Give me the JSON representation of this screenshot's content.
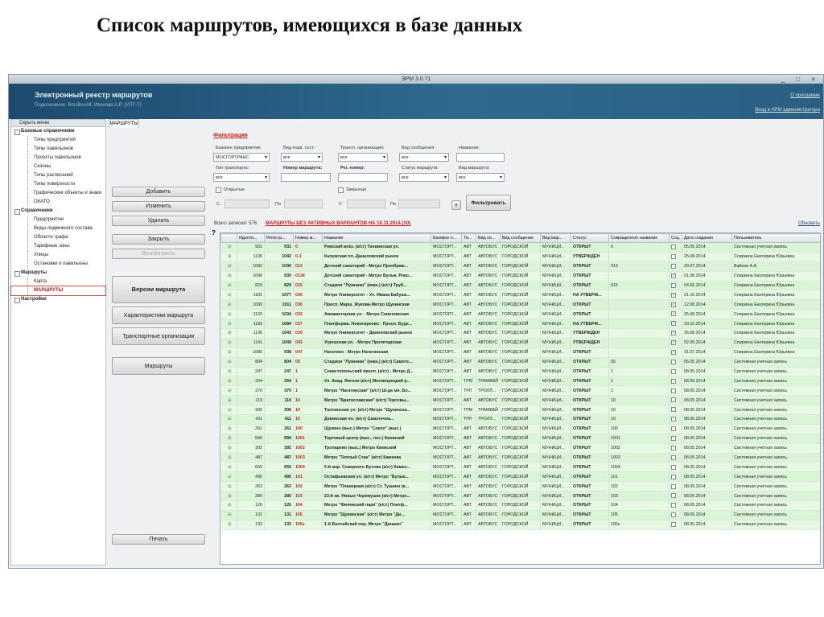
{
  "slide_title": "Список маршрутов, имеющихся в базе данных",
  "window": {
    "title": "ЭРМ 3.0.71",
    "controls": "_ □ ×"
  },
  "banner": {
    "app_name": "Электронный реестр маршрутов",
    "subtitle": "Подключение: BmsBoxAll, Иванова А.Р. (УПТ-Т)",
    "about_link": "О программе",
    "admin_link": "Вход в АРМ администратора"
  },
  "nav": {
    "hide_label": "Скрыть меню",
    "items": [
      {
        "label": "Базовые справочники",
        "type": "grp"
      },
      {
        "label": "Типы предприятий",
        "type": "leaf"
      },
      {
        "label": "Типы павильонов",
        "type": "leaf"
      },
      {
        "label": "Проекты павильонов",
        "type": "leaf"
      },
      {
        "label": "Сезоны",
        "type": "leaf"
      },
      {
        "label": "Типы расписаний",
        "type": "leaf"
      },
      {
        "label": "Типы поверхности",
        "type": "leaf"
      },
      {
        "label": "Графические объекты и знаки",
        "type": "leaf"
      },
      {
        "label": "ОКАТО",
        "type": "leaf"
      },
      {
        "label": "Справочники",
        "type": "grp"
      },
      {
        "label": "Предприятия",
        "type": "leaf"
      },
      {
        "label": "Виды подвижного состава",
        "type": "leaf"
      },
      {
        "label": "Области графа",
        "type": "leaf"
      },
      {
        "label": "Тарифные зоны",
        "type": "leaf"
      },
      {
        "label": "Улицы",
        "type": "leaf"
      },
      {
        "label": "Остановки и павильоны",
        "type": "leaf"
      },
      {
        "label": "Маршруты",
        "type": "grp"
      },
      {
        "label": "Карта",
        "type": "leaf"
      },
      {
        "label": "МАРШРУТЫ",
        "type": "leaf",
        "selected": true
      },
      {
        "label": "Настройки",
        "type": "grp"
      }
    ]
  },
  "tab": {
    "label": "МАРШРУТЫ"
  },
  "buttons": {
    "add": "Добавить",
    "edit": "Изменить",
    "delete": "Удалить",
    "close": "Закрыть",
    "reopen": "Возобновить",
    "versions": "Версии маршрута",
    "characteristics": "Характеристики маршрута",
    "carriers": "Транспортные организации",
    "routes": "Маршруты",
    "print": "Печать"
  },
  "filter": {
    "header": "Фильтрация",
    "base_enterprise": {
      "label": "Базовое предприятие:",
      "value": "МОСГОРТРАНС"
    },
    "subst_type": {
      "label": "Вид подв. сост.:",
      "value": "все"
    },
    "transport_org": {
      "label": "Трансп. организация:",
      "value": "все"
    },
    "msg_type": {
      "label": "Вид сообщения:",
      "value": "все"
    },
    "name": {
      "label": "Название:"
    },
    "transport_type": {
      "label": "Тип транспорта:",
      "value": "все"
    },
    "route_number": {
      "label": "Номер маршрута:"
    },
    "reg_number": {
      "label": "Рег. номер:"
    },
    "route_status": {
      "label": "Статус маршрута:",
      "value": "все"
    },
    "route_kind": {
      "label": "Вид маршрута:",
      "value": "все"
    },
    "opened": "Открытые",
    "closed": "Закрытые",
    "from1": "С",
    "to1": "По",
    "from2": "С",
    "to2": "По",
    "plus": "+",
    "apply": "Фильтровать"
  },
  "total": "Всего записей: 576",
  "warning": "МАРШРУТЫ БЕЗ АКТИВНЫХ ВАРИАНТОВ НА 18.11.2014 (10)",
  "refresh": "Обновить",
  "qmark": "?",
  "table": {
    "columns": [
      "",
      "Иденти...",
      "Регистр...",
      "Номер м...",
      "Название",
      "Базовое п...",
      "Ти...",
      "Вид по...",
      "Вид сообщения",
      "Вид мар...",
      "Статус",
      "Сокращенное название",
      "Соц.",
      "Дата создания",
      "Пользователь"
    ],
    "rows": [
      [
        "931",
        "931",
        "0",
        "Рижский вокз. (к/ст) Тихвинская ул.",
        "МОСГОРТ...",
        "АВТ",
        "АВТОБУС",
        "ГОРОДСКОЙ",
        "МУНИЦИ...",
        "ОТКРЫТ",
        "0",
        "",
        "05.05.2014",
        "Системная учетная запись"
      ],
      [
        "1135",
        "1042",
        "0-1",
        "Калужская пл.-Даниловский рынок",
        "МОСГОРТ...",
        "АВТ",
        "АВТОБУС",
        "ГОРОДСКОЙ",
        "МУНИЦИ...",
        "УТВЕРЖДЕН",
        "",
        "",
        "25.08.2014",
        "Спиркина Екатерина Юрьевна"
      ],
      [
        "1082",
        "1030",
        "013",
        "Детский санаторий - Метро Преображ...",
        "МОСГОРТ...",
        "АВТ",
        "АВТОБУС",
        "ГОРОДСКОЙ",
        "МУНИЦИ...",
        "ОТКРЫТ",
        "013",
        "",
        "29.07.2014",
        "Вайнов А.А."
      ],
      [
        "1096",
        "930",
        "013К",
        "Детский санаторий - Метро Бульв. Роко...",
        "МОСГОРТ...",
        "АВТ",
        "АВТОБУС",
        "ГОРОДСКОЙ",
        "МУНИЦИ...",
        "ОТКРЫТ",
        "",
        "✓",
        "01.08.2014",
        "Спиркина Екатерина Юрьевна"
      ],
      [
        "829",
        "829",
        "015",
        "Стадион \"Лужники\" (южн.) (к/ст) Труб...",
        "МОСГОРТ...",
        "АВТ",
        "АВТОБУС",
        "ГОРОДСКОЙ",
        "МУНИЦИ...",
        "ОТКРЫТ",
        "015",
        "",
        "04.06.2014",
        "Спиркина Екатерина Юрьевна"
      ],
      [
        "1181",
        "1077",
        "026",
        "Метро Университет - Ул. Ивана Бабушк...",
        "МОСГОРТ...",
        "АВТ",
        "АВТОБУС",
        "ГОРОДСКОЙ",
        "МУНИЦИ...",
        "НА УТВЕРЖ...",
        "",
        "✓",
        "21.10.2014",
        "Спиркина Екатерина Юрьевна"
      ],
      [
        "1099",
        "1011",
        "030",
        "Просп. Марш. Жукова-Метро Щукинская",
        "МОСГОРТ...",
        "АВТ",
        "АВТОБУС",
        "ГОРОДСКОЙ",
        "МУНИЦИ...",
        "ОТКРЫТ",
        "",
        "✓",
        "12.08.2014",
        "Спиркина Екатерина Юрьевна"
      ],
      [
        "1132",
        "1034",
        "032",
        "Авиамоторная ул. - Метро Семеновская",
        "МОСГОРТ...",
        "АВТ",
        "АВТОБУС",
        "ГОРОДСКОЙ",
        "МУНИЦИ...",
        "ОТКРЫТ",
        "",
        "✓",
        "25.08.2014",
        "Спиркина Екатерина Юрьевна"
      ],
      [
        "1183",
        "1084",
        "037",
        "Платформа. Новогиреево - Просп. Буде...",
        "МОСГОРТ...",
        "АВТ",
        "АВТОБУС",
        "ГОРОДСКОЙ",
        "МУНИЦИ...",
        "НА УТВЕРЖ...",
        "",
        "✓",
        "29.10.2014",
        "Спиркина Екатерина Юрьевна"
      ],
      [
        "1136",
        "1043",
        "039",
        "Метро Университет - Даниловский рынок",
        "МОСГОРТ...",
        "АВТ",
        "АВТОБУС",
        "ГОРОДСКОЙ",
        "МУНИЦИ...",
        "УТВЕРЖДЕН",
        "",
        "✓",
        "26.08.2014",
        "Спиркина Екатерина Юрьевна"
      ],
      [
        "1141",
        "1049",
        "043",
        "Угрешская ул. - Метро Пролетарская",
        "МОСГОРТ...",
        "АВТ",
        "АВТОБУС",
        "ГОРОДСКОЙ",
        "МУНИЦИ...",
        "УТВЕРЖДЕН",
        "",
        "✓",
        "02.09.2014",
        "Спиркина Екатерина Юрьевна"
      ],
      [
        "1085",
        "938",
        "047",
        "Нагатино - Метро Нагатинская",
        "МОСГОРТ...",
        "АВТ",
        "АВТОБУС",
        "ГОРОДСКОЙ",
        "МУНИЦИ...",
        "ОТКРЫТ",
        "",
        "✓",
        "31.07.2014",
        "Спиркина Екатерина Юрьевна"
      ],
      [
        "804",
        "804",
        "05",
        "Стадион \"Лужники\" (южн.) (к/ст) Самоте...",
        "МОСГОРТ...",
        "АВТ",
        "АВТОБУС",
        "ГОРОДСКОЙ",
        "МУНИЦИ...",
        "ОТКРЫТ",
        "05",
        "",
        "05.05.2014",
        "Системная учетная запись"
      ],
      [
        "247",
        "247",
        "1",
        "Севастопольский просп. (к/ст) - Метро Д...",
        "МОСГОРТ...",
        "АВТ",
        "АВТОБУС",
        "ГОРОДСКОЙ",
        "МУНИЦИ...",
        "ОТКРЫТ",
        "1",
        "",
        "08.05.2014",
        "Системная учетная запись"
      ],
      [
        "254",
        "254",
        "1",
        "Ул. Акад. Янгеля (к/ст) Москворецкий р...",
        "МОСГОРТ...",
        "ТРМ",
        "ТРАМВАЙ",
        "ГОРОДСКОЙ",
        "МУНИЦИ...",
        "ОТКРЫТ",
        "1",
        "",
        "08.05.2014",
        "Системная учетная запись"
      ],
      [
        "370",
        "370",
        "1",
        "Метро \"Нагатинская\" (к/ст) Ш-да мн. Бо...",
        "МОСГОРТ...",
        "ТРЛ",
        "ТРОЛЛ...",
        "ГОРОДСКОЙ",
        "МУНИЦИ...",
        "ОТКРЫТ",
        "1",
        "",
        "08.05.2014",
        "Системная учетная запись"
      ],
      [
        "119",
        "119",
        "10",
        "Метро \"Братиславская\" (к/ст) Торговы...",
        "МОСГОРТ...",
        "АВТ",
        "АВТОБУС",
        "ГОРОДСКОЙ",
        "МУНИЦИ...",
        "ОТКРЫТ",
        "10",
        "",
        "08.05.2014",
        "Системная учетная запись"
      ],
      [
        "306",
        "306",
        "10",
        "Таллинская ул. (к/ст) Метро \"Щукинска...",
        "МОСГОРТ...",
        "ТРМ",
        "ТРАМВАЙ",
        "ГОРОДСКОЙ",
        "МУНИЦИ...",
        "ОТКРЫТ",
        "10",
        "",
        "08.05.2014",
        "Системная учетная запись"
      ],
      [
        "411",
        "411",
        "10",
        "Дзвинская пл. (к/ст) Самотечна...",
        "МОСГОРТ...",
        "ТРЛ",
        "ТРОЛЛ...",
        "ГОРОДСКОЙ",
        "МУНИЦИ...",
        "ОТКРЫТ",
        "10",
        "",
        "08.05.2014",
        "Системная учетная запись"
      ],
      [
        "261",
        "261",
        "100",
        "Щукино (выс.) Метро \"Сокол\" (выс.)",
        "МОСГОРТ...",
        "АВТ",
        "АВТОБУС",
        "ГОРОДСКОЙ",
        "МУНИЦИ...",
        "ОТКРЫТ",
        "100",
        "",
        "08.05.2014",
        "Системная учетная запись"
      ],
      [
        "584",
        "584",
        "1001",
        "Торговый центр (выс., пос.) Киевский",
        "МОСГОРТ...",
        "АВТ",
        "АВТОБУС",
        "ГОРОДСКОЙ",
        "МУНИЦИ...",
        "ОТКРЫТ",
        "1001",
        "",
        "08.05.2014",
        "Системная учетная запись"
      ],
      [
        "392",
        "392",
        "1002",
        "Тропарево (выс.) Метро Киевский",
        "МОСГОРТ...",
        "АВТ",
        "АВТОБУС",
        "ГОРОДСКОЙ",
        "МУНИЦИ...",
        "ОТКРЫТ",
        "1002",
        "",
        "08.05.2014",
        "Системная учетная запись"
      ],
      [
        "487",
        "487",
        "1003",
        "Метро \"Теплый Стан\" (к/ст) Каменка",
        "МОСГОРТ...",
        "АВТ",
        "АВТОБУС",
        "ГОРОДСКОЙ",
        "МУНИЦИ...",
        "ОТКРЫТ",
        "1003",
        "",
        "08.05.2014",
        "Системная учетная запись"
      ],
      [
        "655",
        "655",
        "1004",
        "5-й мкр. Северного Бутова (к/ст) Камен...",
        "МОСГОРТ...",
        "АВТ",
        "АВТОБУС",
        "ГОРОДСКОЙ",
        "МУНИЦИ...",
        "ОТКРЫТ",
        "1004",
        "",
        "08.05.2014",
        "Системная учетная запись"
      ],
      [
        "495",
        "495",
        "101",
        "Остафьевская ул. (к/ст) Метро \"Бульв...",
        "МОСГОРТ...",
        "АВТ",
        "АВТОБУС",
        "ГОРОДСКОЙ",
        "МУНИЦИ...",
        "ОТКРЫТ",
        "101",
        "",
        "08.05.2014",
        "Системная учетная запись"
      ],
      [
        "263",
        "263",
        "102",
        "Метро \"Планерная (к/ст) Ст. Тушино (в...",
        "МОСГОРТ...",
        "АВТ",
        "АВТОБУС",
        "ГОРОДСКОЙ",
        "МУНИЦИ...",
        "ОТКРЫТ",
        "102",
        "",
        "08.05.2014",
        "Системная учетная запись"
      ],
      [
        "280",
        "280",
        "103",
        "23-й кв. Новых Черемушек (к/ст) Метро...",
        "МОСГОРТ...",
        "АВТ",
        "АВТОБУС",
        "ГОРОДСКОЙ",
        "МУНИЦИ...",
        "ОТКРЫТ",
        "103",
        "",
        "08.05.2014",
        "Системная учетная запись"
      ],
      [
        "126",
        "126",
        "104",
        "Метро \"Филевский парк\" (к/ст) Платф...",
        "МОСГОРТ...",
        "АВТ",
        "АВТОБУС",
        "ГОРОДСКОЙ",
        "МУНИЦИ...",
        "ОТКРЫТ",
        "104",
        "",
        "08.05.2014",
        "Системная учетная запись"
      ],
      [
        "131",
        "131",
        "105",
        "Метро \"Щукинская\" (к/ст) Метро \"Ди...",
        "МОСГОРТ...",
        "АВТ",
        "АВТОБУС",
        "ГОРОДСКОЙ",
        "МУНИЦИ...",
        "ОТКРЫТ",
        "105",
        "",
        "08.05.2014",
        "Системная учетная запись"
      ],
      [
        "133",
        "133",
        "105к",
        "1-й Балтийский пер. Метро \"Динамо\"",
        "МОСГОРТ...",
        "АВТ",
        "АВТОБУС",
        "ГОРОДСКОЙ",
        "МУНИЦИ...",
        "ОТКРЫТ",
        "105к",
        "",
        "08.05.2014",
        "Системная учетная запись"
      ]
    ]
  }
}
